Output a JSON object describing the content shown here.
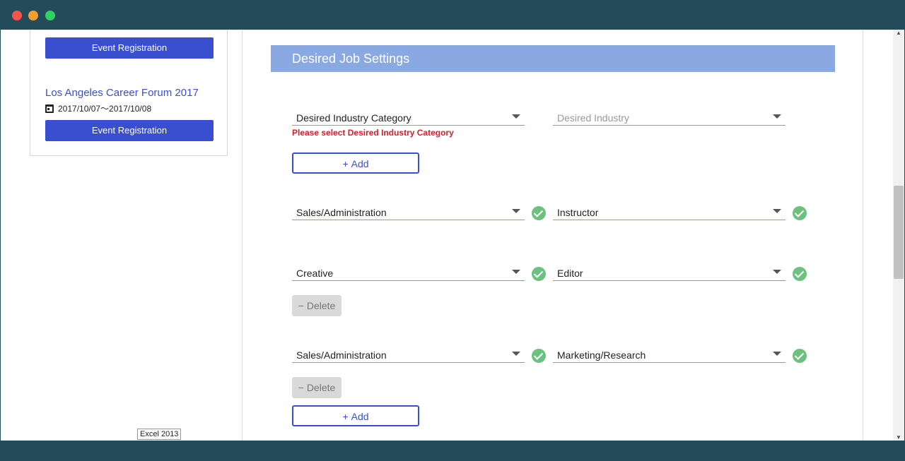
{
  "sidebar": {
    "event_button_label": "Event Registration",
    "event_title": "Los Angeles Career Forum 2017",
    "event_date": "2017/10/07〜2017/10/08",
    "tooltip": "Excel 2013"
  },
  "main": {
    "section_title": "Desired Job Settings",
    "first_row": {
      "category": "Desired Industry Category",
      "industry_placeholder": "Desired Industry",
      "error": "Please select Desired Industry Category"
    },
    "rows": [
      {
        "category": "Sales/Administration",
        "industry": "Instructor"
      },
      {
        "category": "Creative",
        "industry": "Editor"
      },
      {
        "category": "Sales/Administration",
        "industry": "Marketing/Research"
      }
    ],
    "add_label": "Add",
    "add_symbol": "+",
    "delete_label": "Delete",
    "delete_symbol": "−"
  },
  "colors": {
    "accent": "#3a4fcf",
    "header": "#8aa8e2",
    "underline": "#e6892a",
    "error": "#d0202a",
    "check": "#6cc17f"
  }
}
